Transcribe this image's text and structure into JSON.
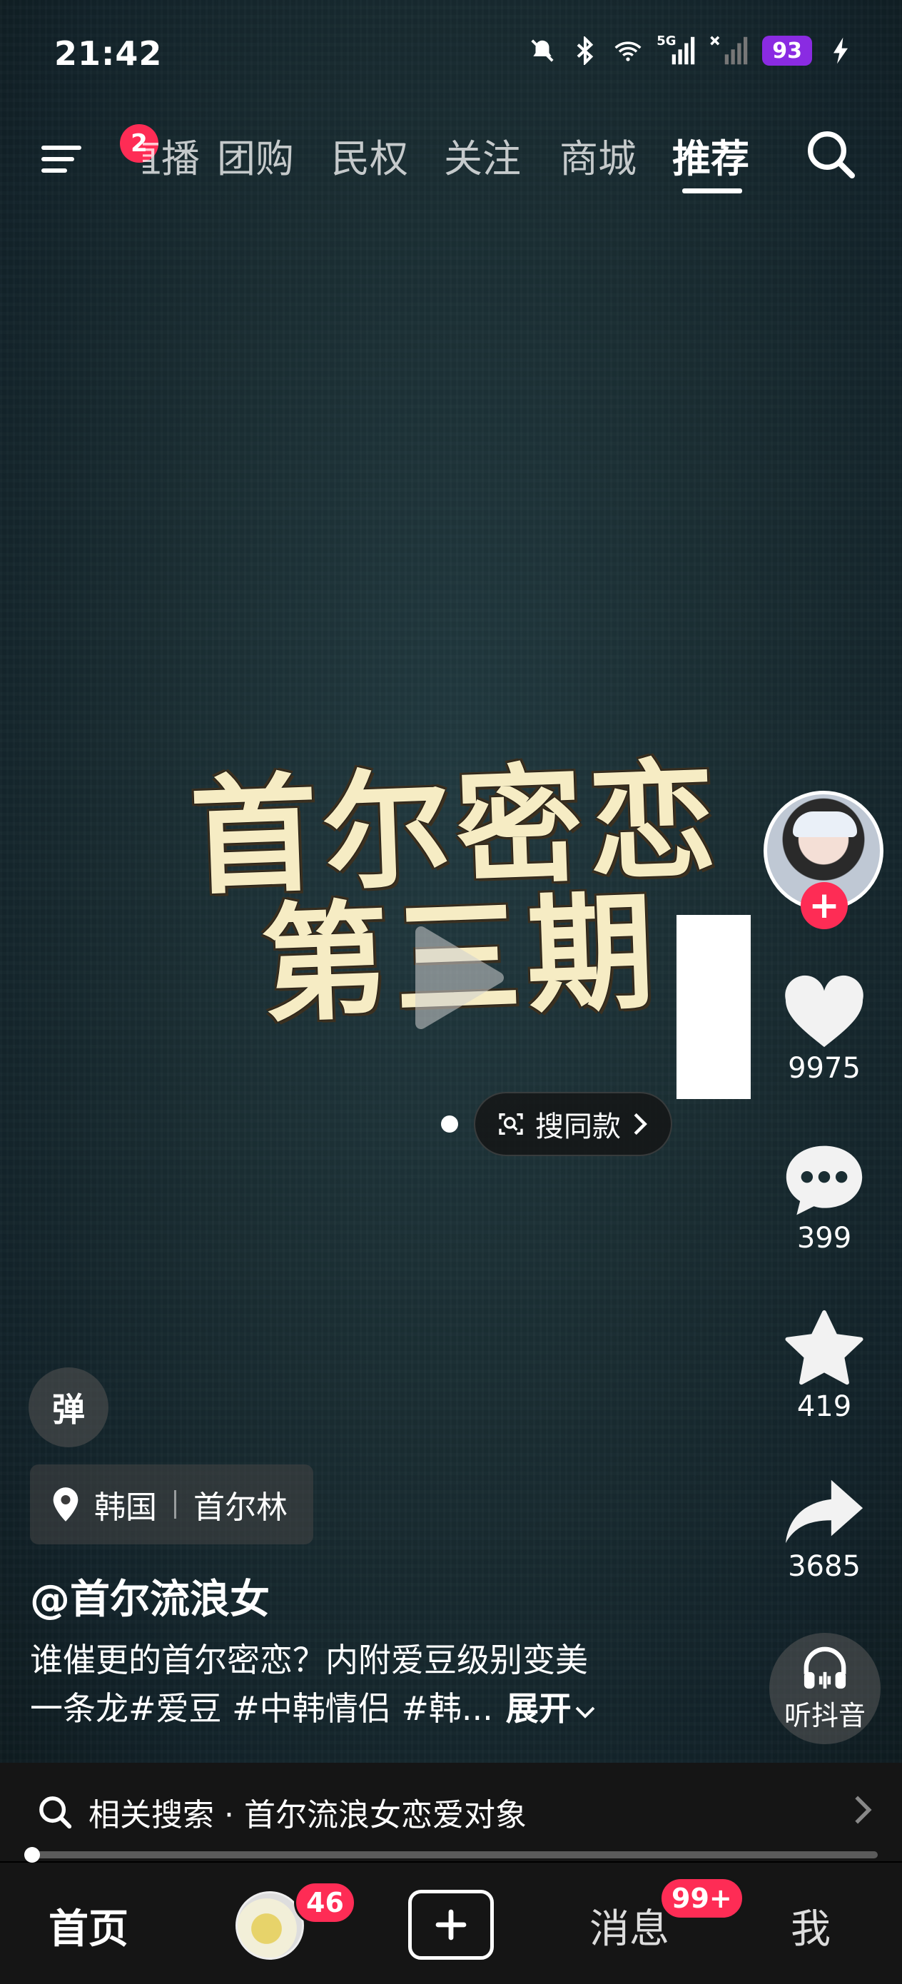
{
  "status_bar": {
    "time": "21:42",
    "network": "5G",
    "battery": "93",
    "icons": [
      "mute-bell-icon",
      "bluetooth-icon",
      "wifi-icon",
      "signal-5g-icon",
      "signal-nosim-icon",
      "battery-icon",
      "charging-icon"
    ]
  },
  "top_nav": {
    "menu_badge": "2",
    "tabs": [
      {
        "label": "直播"
      },
      {
        "label": "团购"
      },
      {
        "label": "民权"
      },
      {
        "label": "关注"
      },
      {
        "label": "商城"
      },
      {
        "label": "推荐"
      }
    ],
    "active_tab": "推荐"
  },
  "video": {
    "title_line1": "首尔密恋",
    "title_line2": "第三期",
    "search_same_label": "搜同款"
  },
  "actions": {
    "likes": "9975",
    "comments": "399",
    "favorites": "419",
    "shares": "3685",
    "listen_label": "听抖音"
  },
  "info": {
    "danmu_label": "弹",
    "location_country": "韩国",
    "location_place": "首尔林",
    "author": "@首尔流浪女",
    "desc_line1": "谁催更的首尔密恋？内附爱豆级别变美",
    "desc_line2": "一条龙#爱豆 #中韩情侣 #韩...",
    "expand_label": "展开"
  },
  "related_search": {
    "text": "相关搜索 · 首尔流浪女恋爱对象"
  },
  "progress": {
    "fraction": 0.0
  },
  "tabbar": {
    "home": "首页",
    "friends_badge": "46",
    "messages": "消息",
    "messages_badge": "99+",
    "me": "我"
  },
  "colors": {
    "accent": "#fe2c55",
    "battery": "#8a2be2",
    "video_bg": "#1a2e33"
  }
}
